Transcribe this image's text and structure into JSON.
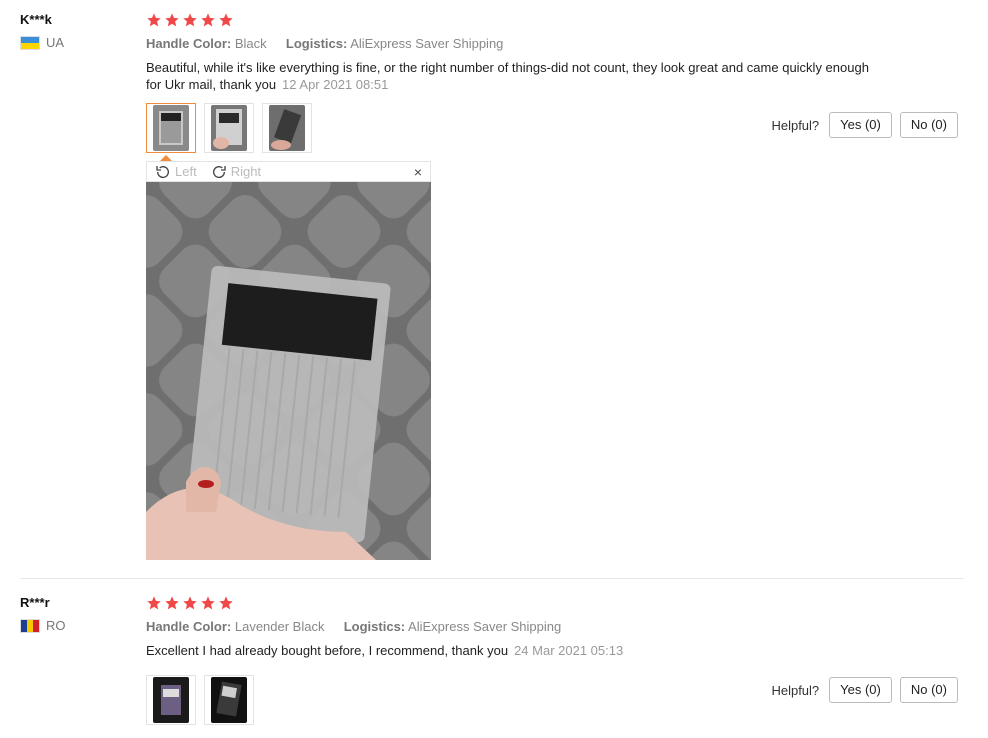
{
  "reviews": [
    {
      "user": "K***k",
      "country": "UA",
      "rating": 5,
      "handle_label": "Handle Color:",
      "handle_value": "Black",
      "logistics_label": "Logistics:",
      "logistics_value": "AliExpress Saver Shipping",
      "text": "Beautiful, while it's like everything is fine, or the right number of things-did not count, they look great and came quickly enough for Ukr mail, thank you",
      "date": "12 Apr 2021 08:51",
      "helpful_label": "Helpful?",
      "yes_label": "Yes (0)",
      "no_label": "No (0)"
    },
    {
      "user": "R***r",
      "country": "RO",
      "rating": 5,
      "handle_label": "Handle Color:",
      "handle_value": "Lavender Black",
      "logistics_label": "Logistics:",
      "logistics_value": "AliExpress Saver Shipping",
      "text": "Excellent I had already bought before, I recommend, thank you",
      "date": "24 Mar 2021 05:13",
      "helpful_label": "Helpful?",
      "yes_label": "Yes (0)",
      "no_label": "No (0)"
    }
  ],
  "viewer": {
    "rotate_left": "Left",
    "rotate_right": "Right",
    "close": "×"
  },
  "colors": {
    "star": "#f04848",
    "active_thumb": "#f08c3b"
  }
}
